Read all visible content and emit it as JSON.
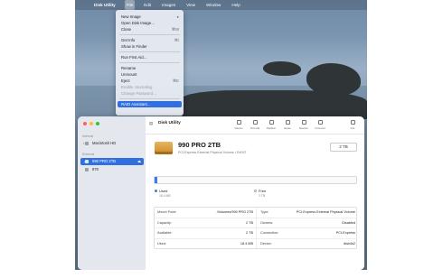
{
  "menubar": {
    "app": "Disk Utility",
    "items": [
      "File",
      "Edit",
      "Images",
      "View",
      "Window",
      "Help"
    ]
  },
  "file_menu": {
    "items": [
      {
        "label": "New Image",
        "shortcut": "▸",
        "disabled": false
      },
      {
        "label": "Open Disk Image…",
        "shortcut": "",
        "disabled": false
      },
      {
        "label": "Close",
        "shortcut": "⌘W",
        "disabled": false
      },
      {
        "sep": true
      },
      {
        "label": "Get Info",
        "shortcut": "⌘I",
        "disabled": false
      },
      {
        "label": "Show in Finder",
        "shortcut": "",
        "disabled": false
      },
      {
        "sep": true
      },
      {
        "label": "Run First Aid…",
        "shortcut": "",
        "disabled": false
      },
      {
        "sep": true
      },
      {
        "label": "Rename",
        "shortcut": "",
        "disabled": false
      },
      {
        "label": "Unmount",
        "shortcut": "",
        "disabled": false
      },
      {
        "label": "Eject",
        "shortcut": "⌘E",
        "disabled": false
      },
      {
        "label": "Enable Journaling",
        "shortcut": "",
        "disabled": true
      },
      {
        "label": "Change Password…",
        "shortcut": "",
        "disabled": true
      },
      {
        "sep": true
      },
      {
        "label": "RAID Assistant…",
        "shortcut": "",
        "disabled": false,
        "selected": true
      }
    ]
  },
  "sidebar": {
    "internal_heading": "Internal",
    "external_heading": "External",
    "internal_items": [
      {
        "label": "Macintosh HD"
      }
    ],
    "external_items": [
      {
        "label": "990 PRO 2TB",
        "selected": true
      },
      {
        "label": "970"
      }
    ]
  },
  "toolbar": {
    "title": "Disk Utility",
    "view_label": "View",
    "buttons": [
      "Volume",
      "First Aid",
      "Partition",
      "Erase",
      "Restore",
      "Unmount",
      "Info"
    ]
  },
  "drive": {
    "name": "990 PRO 2TB",
    "subtitle": "PCI-Express External Physical Volume • ExFAT",
    "size": "2 TB"
  },
  "usage": {
    "used_fraction": 0.01,
    "used_label": "Used",
    "used_value": "18.4 MB",
    "free_label": "Free",
    "free_value": "2 TB",
    "used_color": "#3b7de8",
    "free_color": "#e6e6e6"
  },
  "info": {
    "rows": [
      {
        "k1": "Mount Point:",
        "v1": "/Volumes/990 PRO 2TB",
        "k2": "Type:",
        "v2": "PCI-Express External Physical Volume"
      },
      {
        "k1": "Capacity:",
        "v1": "2 TB",
        "k2": "Owners:",
        "v2": "Disabled"
      },
      {
        "k1": "Available:",
        "v1": "2 TB",
        "k2": "Connection:",
        "v2": "PCI-Express"
      },
      {
        "k1": "Used:",
        "v1": "18.4 MB",
        "k2": "Device:",
        "v2": "disk4s2"
      }
    ]
  }
}
